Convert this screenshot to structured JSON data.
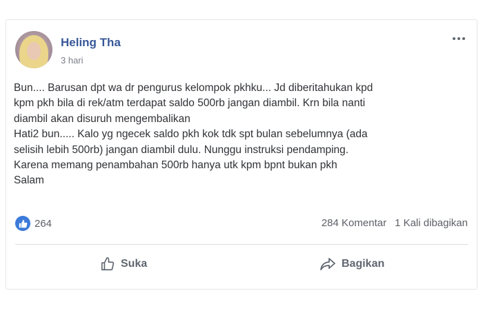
{
  "post": {
    "author": "Heling Tha",
    "time": "3 hari",
    "text": "Bun.... Barusan dpt wa dr pengurus kelompok pkhku... Jd diberitahukan kpd\nkpm pkh bila di rek/atm terdapat saldo 500rb jangan diambil. Krn bila nanti\ndiambil akan disuruh mengembalikan\nHati2 bun..... Kalo yg ngecek saldo pkh kok tdk spt bulan sebelumnya (ada\nselisih lebih 500rb) jangan diambil dulu. Nunggu instruksi pendamping.\nKarena memang penambahan 500rb hanya utk kpm bpnt bukan pkh\nSalam"
  },
  "reactions": {
    "count": "264"
  },
  "stats": {
    "comments": "284 Komentar",
    "shares": "1 Kali dibagikan"
  },
  "actions": {
    "like_label": "Suka",
    "share_label": "Bagikan"
  },
  "colors": {
    "author": "#385898",
    "like_badge": "#3b7ad9"
  }
}
